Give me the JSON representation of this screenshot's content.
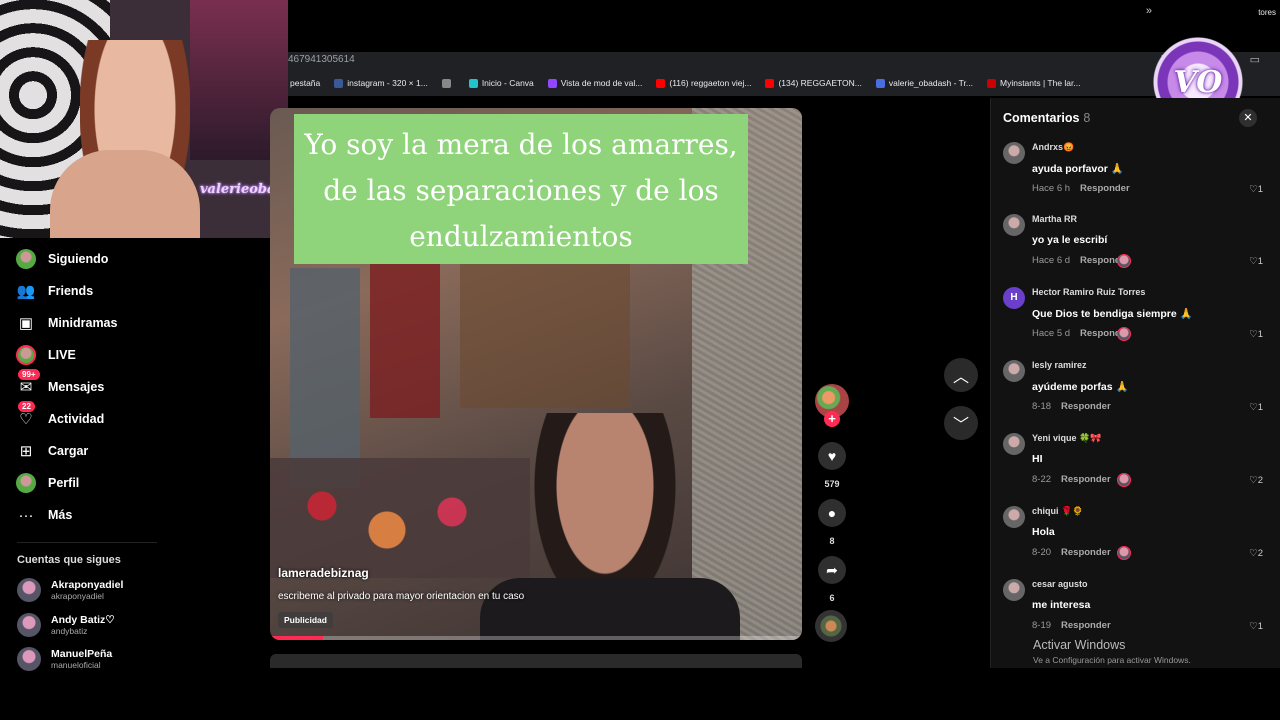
{
  "browser": {
    "url_fragment": "467941305614",
    "bookmarks": [
      {
        "label": "pestaña",
        "color": "#202124"
      },
      {
        "label": "instagram - 320 × 1...",
        "color": "#3b5998"
      },
      {
        "label": "",
        "color": "#888888"
      },
      {
        "label": "Inicio - Canva",
        "color": "#20c4cb"
      },
      {
        "label": "Vista de mod de val...",
        "color": "#9147ff"
      },
      {
        "label": "(116) reggaeton viej...",
        "color": "#ff0000"
      },
      {
        "label": "(134) REGGAETON...",
        "color": "#ff0000"
      },
      {
        "label": "valerie_obadash - Tr...",
        "color": "#4a6ee0"
      },
      {
        "label": "Myinstants | The lar...",
        "color": "#cc0000"
      }
    ],
    "more_label": "»",
    "otros_label": "tores"
  },
  "webcam": {
    "overlay_name": "valerieobadash"
  },
  "sidebar": {
    "items": [
      {
        "label": "Siguiendo",
        "icon": "following-avatar-icon"
      },
      {
        "label": "Friends",
        "icon": "friends-icon"
      },
      {
        "label": "Minidramas",
        "icon": "minidramas-icon"
      },
      {
        "label": "LIVE",
        "icon": "live-icon"
      },
      {
        "label": "Mensajes",
        "icon": "messages-icon",
        "badge": "99+"
      },
      {
        "label": "Actividad",
        "icon": "activity-icon",
        "badge": "22"
      },
      {
        "label": "Cargar",
        "icon": "upload-icon"
      },
      {
        "label": "Perfil",
        "icon": "profile-icon"
      },
      {
        "label": "Más",
        "icon": "more-icon"
      }
    ],
    "following_title": "Cuentas que sigues",
    "accounts": [
      {
        "name": "Akraponyadiel",
        "handle": "akraponyadiel"
      },
      {
        "name": "Andy Batiz♡",
        "handle": "andybatiz"
      },
      {
        "name": "ManuelPeña",
        "handle": "manueloficial"
      }
    ]
  },
  "video": {
    "caption": "Yo soy la mera de los amarres, de las separaciones y de los endulzamientos",
    "username": "lameradebiznag",
    "description": "escribeme al privado para mayor orientacion en tu caso",
    "tag": "Publicidad",
    "progress": 0.1
  },
  "actions": {
    "likes": "579",
    "comments": "8",
    "shares": "6"
  },
  "comments_panel": {
    "title": "Comentarios",
    "count": "8",
    "reply_label": "Responder",
    "comments": [
      {
        "user": "Andrxs😡",
        "text": "ayuda porfavor 🙏",
        "time": "Hace 6 h",
        "likes": "1",
        "creator_liked": false
      },
      {
        "user": "Martha RR",
        "text": "yo ya le escribí",
        "time": "Hace 6 d",
        "likes": "1",
        "creator_liked": true
      },
      {
        "user": "Hector Ramiro Ruiz Torres",
        "text": "Que Dios te bendiga siempre 🙏",
        "time": "Hace 5 d",
        "likes": "1",
        "creator_liked": true,
        "initial": "H"
      },
      {
        "user": "lesly ramirez",
        "text": "ayúdeme porfas 🙏",
        "time": "8-18",
        "likes": "1",
        "creator_liked": false
      },
      {
        "user": "Yeni vique 🍀🎀",
        "text": "HI",
        "time": "8-22",
        "likes": "2",
        "creator_liked": true
      },
      {
        "user": "chiqui 🌹🌻",
        "text": "Hola",
        "time": "8-20",
        "likes": "2",
        "creator_liked": true
      },
      {
        "user": "cesar agusto",
        "text": "me interesa",
        "time": "8-19",
        "likes": "1",
        "creator_liked": false
      }
    ]
  },
  "windows_watermark": {
    "title": "Activar Windows",
    "subtitle": "Ve a Configuración para activar Windows."
  },
  "channel_logo": {
    "text": "VO"
  }
}
